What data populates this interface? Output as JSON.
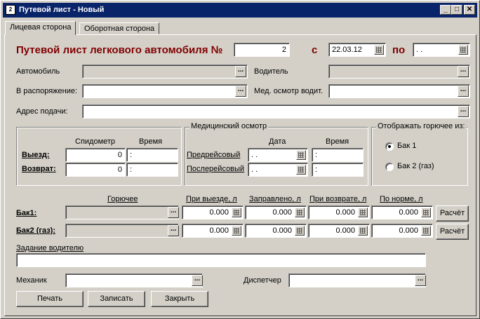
{
  "window": {
    "title": "Путевой лист - Новый",
    "min": "_",
    "max": "□",
    "close": "✕"
  },
  "tabs": [
    {
      "label": "Лицевая сторона"
    },
    {
      "label": "Оборотная сторона"
    }
  ],
  "header": {
    "title": "Путевой лист легкового автомобиля №",
    "number": "2",
    "from_label": "с",
    "from_date": "22.03.12",
    "to_label": "по",
    "to_date": " .  .  "
  },
  "fields": {
    "car_label": "Автомобиль",
    "driver_label": "Водитель",
    "disposal_label": "В распоряжение:",
    "medcheck_label": "Мед. осмотр водит.",
    "address_label": "Адрес подачи:"
  },
  "odometer": {
    "col_speedometer": "Спидометр",
    "col_time": "Время",
    "exit_label": "Выезд:",
    "return_label": "Возврат:",
    "exit_speedometer": "0",
    "exit_time": " :",
    "return_speedometer": "0",
    "return_time": " :"
  },
  "medical": {
    "title": "Медицинский осмотр",
    "col_date": "Дата",
    "col_time": "Время",
    "pre_label": "Предрейсовый",
    "post_label": "Послерейсовый",
    "pre_date": " .  .  ",
    "pre_time": " :",
    "post_date": " .  .  ",
    "post_time": " :"
  },
  "fuel_display": {
    "title": "Отображать горючее из:",
    "options": [
      {
        "label": "Бак 1",
        "selected": true
      },
      {
        "label": "Бак 2 (газ)",
        "selected": false
      }
    ]
  },
  "fuel_table": {
    "col_fuel": "Горючее",
    "col_exit": "При выезде, л",
    "col_filled": "Заправлено, л",
    "col_return": "При возврате, л",
    "col_norm": "По норме, л",
    "rows": [
      {
        "label": "Бак1:",
        "exit": "0.000",
        "filled": "0.000",
        "return": "0.000",
        "norm": "0.000",
        "calc_label": "Расчёт"
      },
      {
        "label": "Бак2 (газ):",
        "exit": "0.000",
        "filled": "0.000",
        "return": "0.000",
        "norm": "0.000",
        "calc_label": "Расчёт"
      }
    ]
  },
  "task": {
    "label": "Задание водителю"
  },
  "staff": {
    "mechanic_label": "Механик",
    "dispatcher_label": "Диспетчер"
  },
  "actions": {
    "print": "Печать",
    "save": "Записать",
    "close": "Закрыть"
  },
  "ellipsis": "..."
}
